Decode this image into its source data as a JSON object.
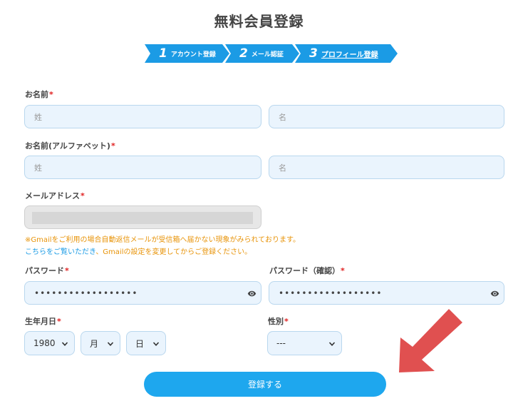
{
  "page": {
    "title": "無料会員登録"
  },
  "steps": [
    {
      "num": "1",
      "label": "アカウント登録"
    },
    {
      "num": "2",
      "label": "メール認証"
    },
    {
      "num": "3",
      "label": "プロフィール登録"
    }
  ],
  "form": {
    "name": {
      "label": "お名前",
      "required": "*",
      "last_placeholder": "姓",
      "first_placeholder": "名"
    },
    "name_alpha": {
      "label": "お名前(アルファベット)",
      "required": "*",
      "last_placeholder": "姓",
      "first_placeholder": "名"
    },
    "email": {
      "label": "メールアドレス",
      "required": "*"
    },
    "notice": {
      "line1": "※Gmailをご利用の場合自動返信メールが受信箱へ届かない現象がみられております。",
      "link": "こちらをご覧いただき",
      "line2_rest": "、Gmailの設定を変更してからご登録ください。"
    },
    "password": {
      "label": "パスワード",
      "required": "*",
      "value": "••••••••••••••••••"
    },
    "password_confirm": {
      "label": "パスワード（確認）",
      "required": "*",
      "value": "••••••••••••••••••"
    },
    "birth": {
      "label": "生年月日",
      "required": "*",
      "year": "1980",
      "month": "月",
      "day": "日"
    },
    "gender": {
      "label": "性別",
      "required": "*",
      "value": "---"
    },
    "submit_label": "登録する"
  },
  "colors": {
    "accent": "#1b9be5",
    "required": "#e02020",
    "notice": "#e8940a",
    "arrow": "#e05050"
  }
}
